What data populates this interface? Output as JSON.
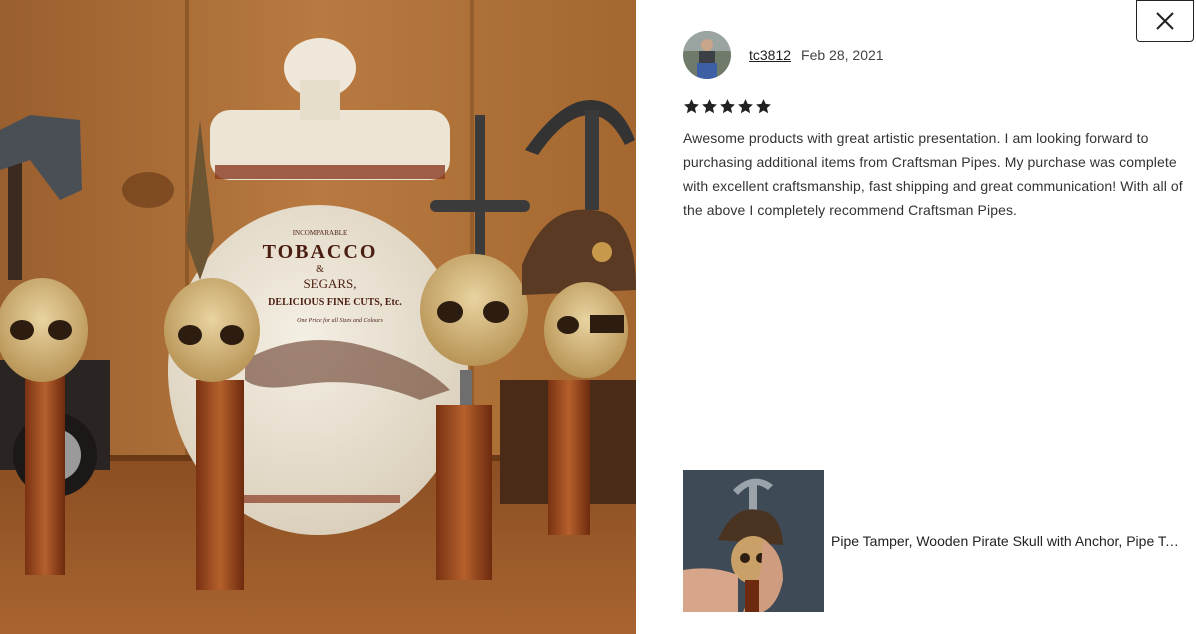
{
  "review": {
    "username": "tc3812",
    "date": "Feb 28, 2021",
    "rating": 5,
    "rating_max": 5,
    "text": "Awesome products with great artistic presentation. I am looking forward to purchasing additional items from Craftsman Pipes. My purchase was complete with excellent craftsmanship, fast shipping and great communication! With all of the above I completely recommend Craftsman Pipes."
  },
  "photo": {
    "jar_label": {
      "top": "INCOMPARABLE",
      "brand": "TOBACCO",
      "amp": "&",
      "line2": "SEGARS,",
      "line3": "DELICIOUS FINE CUTS, Etc.",
      "line4": "One Price for all Sizes and Colours"
    }
  },
  "listing": {
    "title": "Pipe Tamper, Wooden Pirate Skull with Anchor, Pipe Tamper"
  },
  "icons": {
    "close": "close-icon",
    "star": "star-icon"
  },
  "colors": {
    "star": "#222222",
    "wood_wall": "#a86b36",
    "text": "#333333"
  }
}
